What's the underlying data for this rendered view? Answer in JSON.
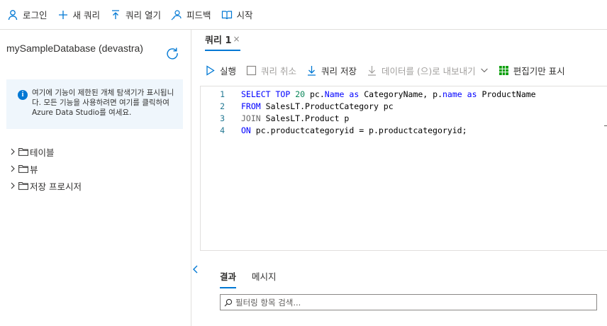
{
  "topbar": {
    "login": "로그인",
    "new_query": "새 쿼리",
    "open_query": "쿼리 열기",
    "feedback": "피드백",
    "getting_started": "시작"
  },
  "left": {
    "db_title": "mySampleDatabase (devastra)",
    "info_text": "여기에 기능이 제한된 개체 탐색기가 표시됩니다. 모든 기능을 사용하려면 여기를 클릭하여 Azure Data Studio를 여세요.",
    "tree": [
      {
        "label": "테이블"
      },
      {
        "label": "뷰"
      },
      {
        "label": "저장 프로시저"
      }
    ]
  },
  "editor_tab": {
    "label": "쿼리 1",
    "close": "×"
  },
  "query_toolbar": {
    "run": "실행",
    "cancel": "쿼리 취소",
    "save": "쿼리 저장",
    "export": "데이터를 (으)로 내보내기",
    "show_editor_only": "편집기만 표시"
  },
  "code_lines": [
    {
      "num": "1"
    },
    {
      "num": "2"
    },
    {
      "num": "3"
    },
    {
      "num": "4"
    }
  ],
  "code": {
    "l1": [
      "SELECT",
      "TOP",
      "20",
      "pc.",
      "Name",
      "as",
      "CategoryName, p.",
      "name",
      "as",
      "ProductName"
    ],
    "l2": [
      "FROM",
      "SalesLT.ProductCategory pc"
    ],
    "l3": [
      "JOIN",
      "SalesLT.Product p"
    ],
    "l4": [
      "ON",
      "pc.productcategoryid = p.productcategoryid;"
    ]
  },
  "results": {
    "tab_results": "결과",
    "tab_messages": "메시지",
    "filter_placeholder": "필터링 항목 검색..."
  },
  "colors": {
    "accent": "#0078d4",
    "keyword": "#0000ff",
    "number": "#098658",
    "line_number": "#237893",
    "info_bg": "#eff6fc",
    "grid_icon": "#10a010"
  }
}
